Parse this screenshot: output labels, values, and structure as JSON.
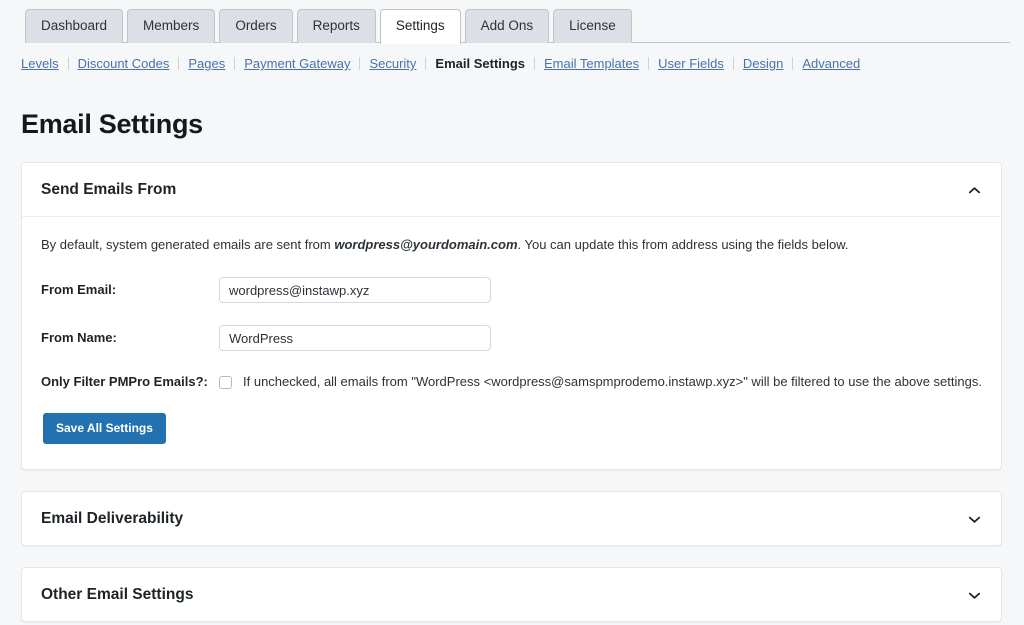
{
  "tabs": [
    {
      "label": "Dashboard",
      "active": false
    },
    {
      "label": "Members",
      "active": false
    },
    {
      "label": "Orders",
      "active": false
    },
    {
      "label": "Reports",
      "active": false
    },
    {
      "label": "Settings",
      "active": true
    },
    {
      "label": "Add Ons",
      "active": false
    },
    {
      "label": "License",
      "active": false
    }
  ],
  "subnav": [
    {
      "label": "Levels",
      "current": false
    },
    {
      "label": "Discount Codes",
      "current": false
    },
    {
      "label": "Pages",
      "current": false
    },
    {
      "label": "Payment Gateway",
      "current": false
    },
    {
      "label": "Security",
      "current": false
    },
    {
      "label": "Email Settings",
      "current": true
    },
    {
      "label": "Email Templates",
      "current": false
    },
    {
      "label": "User Fields",
      "current": false
    },
    {
      "label": "Design",
      "current": false
    },
    {
      "label": "Advanced",
      "current": false
    }
  ],
  "page": {
    "title": "Email Settings"
  },
  "panels": {
    "send_emails_from": {
      "title": "Send Emails From",
      "expanded": true,
      "toggle_icon": "chevron-up-icon",
      "intro_before": "By default, system generated emails are sent from ",
      "intro_email": "wordpress@yourdomain.com",
      "intro_after": ". You can update this from address using the fields below.",
      "fields": {
        "from_email": {
          "label": "From Email:",
          "value": "wordpress@instawp.xyz",
          "placeholder": ""
        },
        "from_name": {
          "label": "From Name:",
          "value": "WordPress",
          "placeholder": ""
        },
        "only_filter": {
          "label": "Only Filter PMPro Emails?:",
          "checked": false,
          "description": "If unchecked, all emails from \"WordPress <wordpress@samspmprodemo.instawp.xyz>\" will be filtered to use the above settings."
        }
      },
      "save_label": "Save All Settings"
    },
    "email_deliverability": {
      "title": "Email Deliverability",
      "expanded": false,
      "toggle_icon": "chevron-down-icon"
    },
    "other_email_settings": {
      "title": "Other Email Settings",
      "expanded": false,
      "toggle_icon": "chevron-down-icon"
    }
  },
  "colors": {
    "page_background": "#f6f7f9",
    "panel_background": "#ffffff",
    "link": "#4b72a5",
    "primary_button": "#2271b1",
    "active_tab_background": "#ffffff",
    "inactive_tab_background": "#dcdfe5"
  }
}
